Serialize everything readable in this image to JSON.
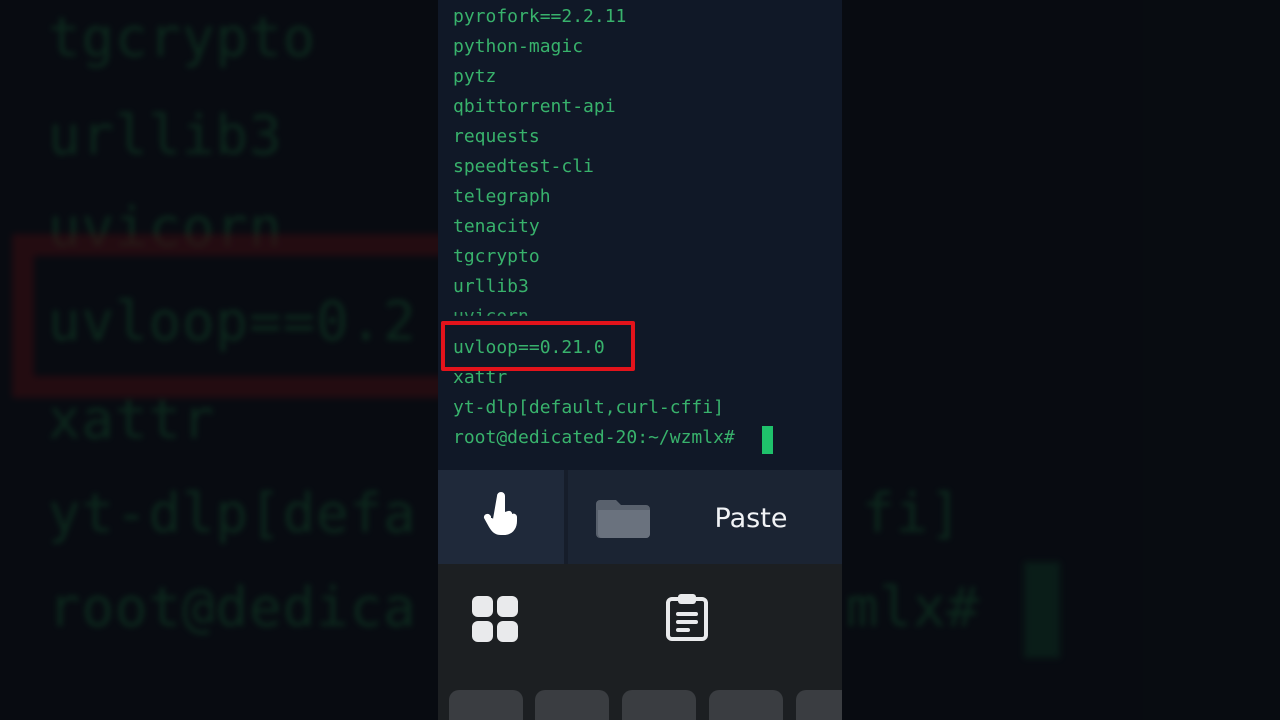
{
  "background_zoom": {
    "lines": [
      "tgcrypto",
      "urllib3",
      "uvicorn",
      "uvloop==0.2",
      "xattr",
      "yt-dlp[defa",
      "root@dedica"
    ],
    "right_fragments": [
      "fi]",
      "mlx#"
    ]
  },
  "terminal": {
    "lines": [
      "pyrofork==2.2.11",
      "python-magic",
      "pytz",
      "qbittorrent-api",
      "requests",
      "speedtest-cli",
      "telegraph",
      "tenacity",
      "tgcrypto",
      "urllib3",
      "uvicorn",
      "uvloop==0.21.0",
      "xattr",
      "yt-dlp[default,curl-cffi]",
      "root@dedicated-20:~/wzmlx#"
    ],
    "highlighted_line": "uvloop==0.21.0"
  },
  "toolbar": {
    "touch_icon": "hand-pointer-icon",
    "folder_icon": "folder-icon",
    "paste_label": "Paste"
  },
  "keyboard": {
    "apps_icon": "grid-icon",
    "clipboard_icon": "clipboard-icon"
  },
  "colors": {
    "terminal_text": "#38b26c",
    "terminal_bg": "#101827",
    "highlight": "#e3131b",
    "cursor": "#1fc16b"
  }
}
